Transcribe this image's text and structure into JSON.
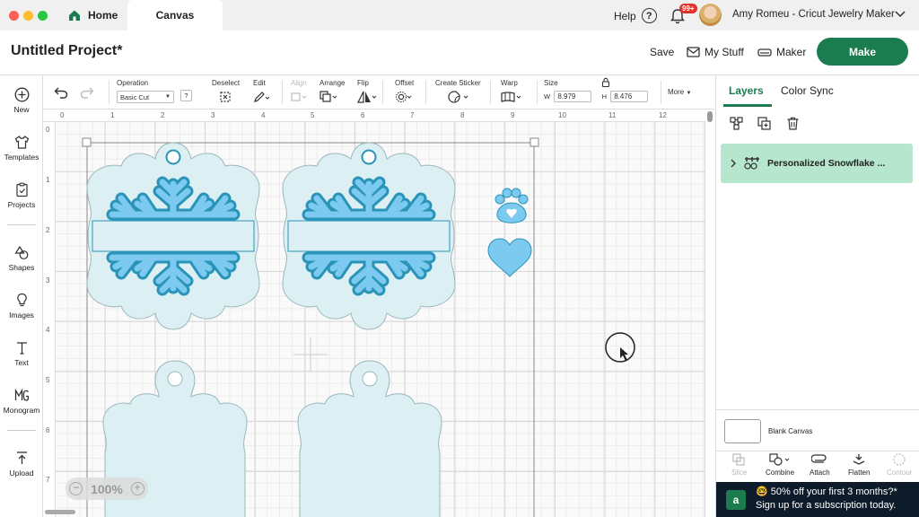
{
  "tabs": {
    "home": "Home",
    "canvas": "Canvas"
  },
  "topbar": {
    "help": "Help",
    "notifications_badge": "99+",
    "user_name": "Amy Romeu - Cricut Jewelry Maker"
  },
  "header": {
    "project_title": "Untitled Project*",
    "save": "Save",
    "my_stuff": "My Stuff",
    "machine": "Maker",
    "make": "Make"
  },
  "sidebar": {
    "items": [
      {
        "label": "New",
        "icon": "plus-circle-icon"
      },
      {
        "label": "Templates",
        "icon": "shirt-icon"
      },
      {
        "label": "Projects",
        "icon": "clipboard-icon"
      },
      {
        "label": "Shapes",
        "icon": "shapes-icon"
      },
      {
        "label": "Images",
        "icon": "bulb-icon"
      },
      {
        "label": "Text",
        "icon": "text-icon"
      },
      {
        "label": "Monogram",
        "icon": "monogram-icon"
      },
      {
        "label": "Upload",
        "icon": "upload-icon"
      }
    ]
  },
  "toolbar": {
    "operation_label": "Operation",
    "operation_value": "Basic Cut",
    "operation_help": "?",
    "deselect": "Deselect",
    "edit": "Edit",
    "align": "Align",
    "arrange": "Arrange",
    "flip": "Flip",
    "offset": "Offset",
    "create_sticker": "Create Sticker",
    "warp": "Warp",
    "size": "Size",
    "width_label": "W",
    "width_value": "8.979",
    "height_label": "H",
    "height_value": "8.476",
    "more": "More"
  },
  "rulers": {
    "x": [
      "0",
      "1",
      "2",
      "3",
      "4",
      "5",
      "6",
      "7",
      "8",
      "9",
      "10",
      "11",
      "12"
    ],
    "y": [
      "0",
      "1",
      "2",
      "3",
      "4",
      "5",
      "6",
      "7"
    ]
  },
  "canvas": {
    "zoom": "100%"
  },
  "panel": {
    "tab_layers": "Layers",
    "tab_color_sync": "Color Sync",
    "layer_name": "Personalized Snowflake ...",
    "blank_canvas": "Blank Canvas",
    "tools": [
      "Slice",
      "Combine",
      "Attach",
      "Flatten",
      "Contour"
    ],
    "promo_line1": "50% off your first 3 months?*",
    "promo_line2": "Sign up for a subscription today."
  },
  "colors": {
    "brand_green": "#1b7d4f",
    "snowflake_light": "#7ccaf0",
    "snowflake_dark": "#2a93b8",
    "tag_base": "#dceff3",
    "layer_highlight": "#b6e6cd"
  }
}
